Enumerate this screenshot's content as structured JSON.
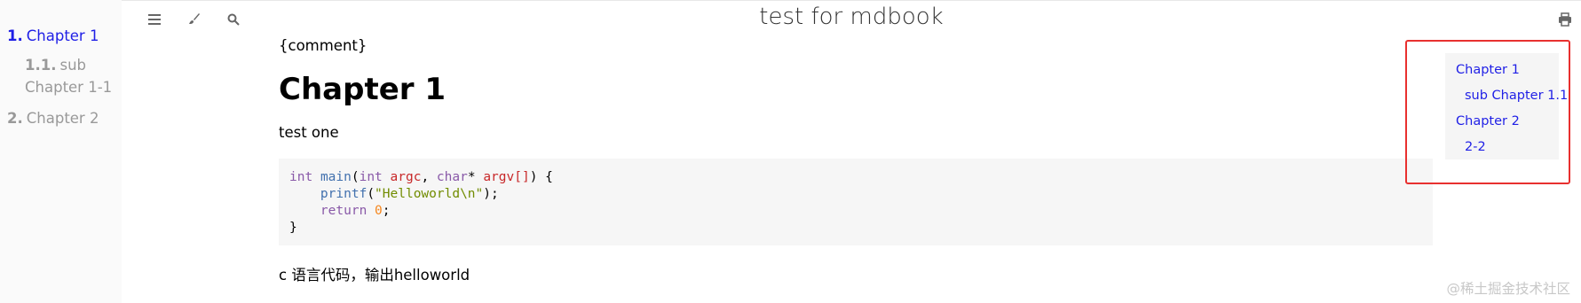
{
  "sidebar": {
    "items": [
      {
        "num": "1.",
        "label": "Chapter 1"
      },
      {
        "num": "1.1.",
        "label": "sub Chapter 1-1"
      },
      {
        "num": "2.",
        "label": "Chapter 2"
      }
    ]
  },
  "header": {
    "title": "test for mdbook",
    "menu_icon": "hamburger-icon",
    "theme_icon": "paintbrush-icon",
    "search_icon": "search-icon",
    "print_icon": "printer-icon"
  },
  "content": {
    "comment": "{comment}",
    "heading": "Chapter 1",
    "paragraph": "test one",
    "code_lines": [
      "int main(int argc, char* argv[]) {",
      "    printf(\"Helloworld\\n\");",
      "    return 0;",
      "}"
    ],
    "paragraph2": "c 语言代码，输出helloworld"
  },
  "toc": {
    "items": [
      {
        "label": "Chapter 1",
        "level": 1
      },
      {
        "label": "sub Chapter 1.1",
        "level": 2
      },
      {
        "label": "Chapter 2",
        "level": 1
      },
      {
        "label": "2-2",
        "level": 2
      }
    ]
  },
  "watermark": "@稀土掘金技术社区",
  "colors": {
    "link": "#1f1fe6",
    "highlight_box": "#e8302f",
    "sidebar_bg": "#fafafa"
  }
}
